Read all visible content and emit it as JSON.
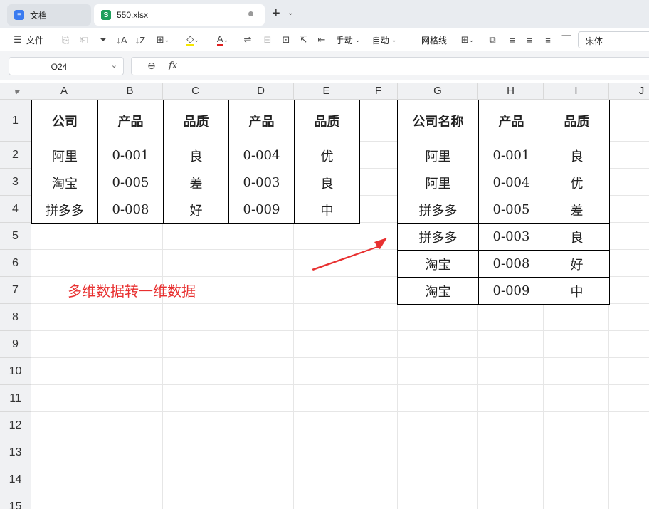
{
  "tabs": [
    {
      "label": "文档"
    },
    {
      "label": "550.xlsx"
    }
  ],
  "toolbar": {
    "file_label": "文件",
    "manual_label": "手动",
    "auto_label": "自动",
    "gridlines_label": "网格线",
    "font_name": "宋体"
  },
  "formula": {
    "cell_ref": "O24",
    "fx_label": "fx",
    "content": ""
  },
  "columns": [
    "A",
    "B",
    "C",
    "D",
    "E",
    "F",
    "G",
    "H",
    "I",
    "J"
  ],
  "rows": [
    "1",
    "2",
    "3",
    "4",
    "5",
    "6",
    "7",
    "8",
    "9",
    "10",
    "11",
    "12",
    "13",
    "14",
    "15"
  ],
  "table_left": {
    "headers": [
      "公司",
      "产品",
      "品质",
      "产品",
      "品质"
    ],
    "rows": [
      [
        "阿里",
        "0-001",
        "良",
        "0-004",
        "优"
      ],
      [
        "淘宝",
        "0-005",
        "差",
        "0-003",
        "良"
      ],
      [
        "拼多多",
        "0-008",
        "好",
        "0-009",
        "中"
      ]
    ]
  },
  "table_right": {
    "headers": [
      "公司名称",
      "产品",
      "品质"
    ],
    "rows": [
      [
        "阿里",
        "0-001",
        "良"
      ],
      [
        "阿里",
        "0-004",
        "优"
      ],
      [
        "拼多多",
        "0-005",
        "差"
      ],
      [
        "拼多多",
        "0-003",
        "良"
      ],
      [
        "淘宝",
        "0-008",
        "好"
      ],
      [
        "淘宝",
        "0-009",
        "中"
      ]
    ]
  },
  "annotation": "多维数据转一维数据",
  "colors": {
    "accent_red": "#e83030",
    "sheet_green": "#1e9e5c",
    "doc_blue": "#3a7bf0"
  }
}
